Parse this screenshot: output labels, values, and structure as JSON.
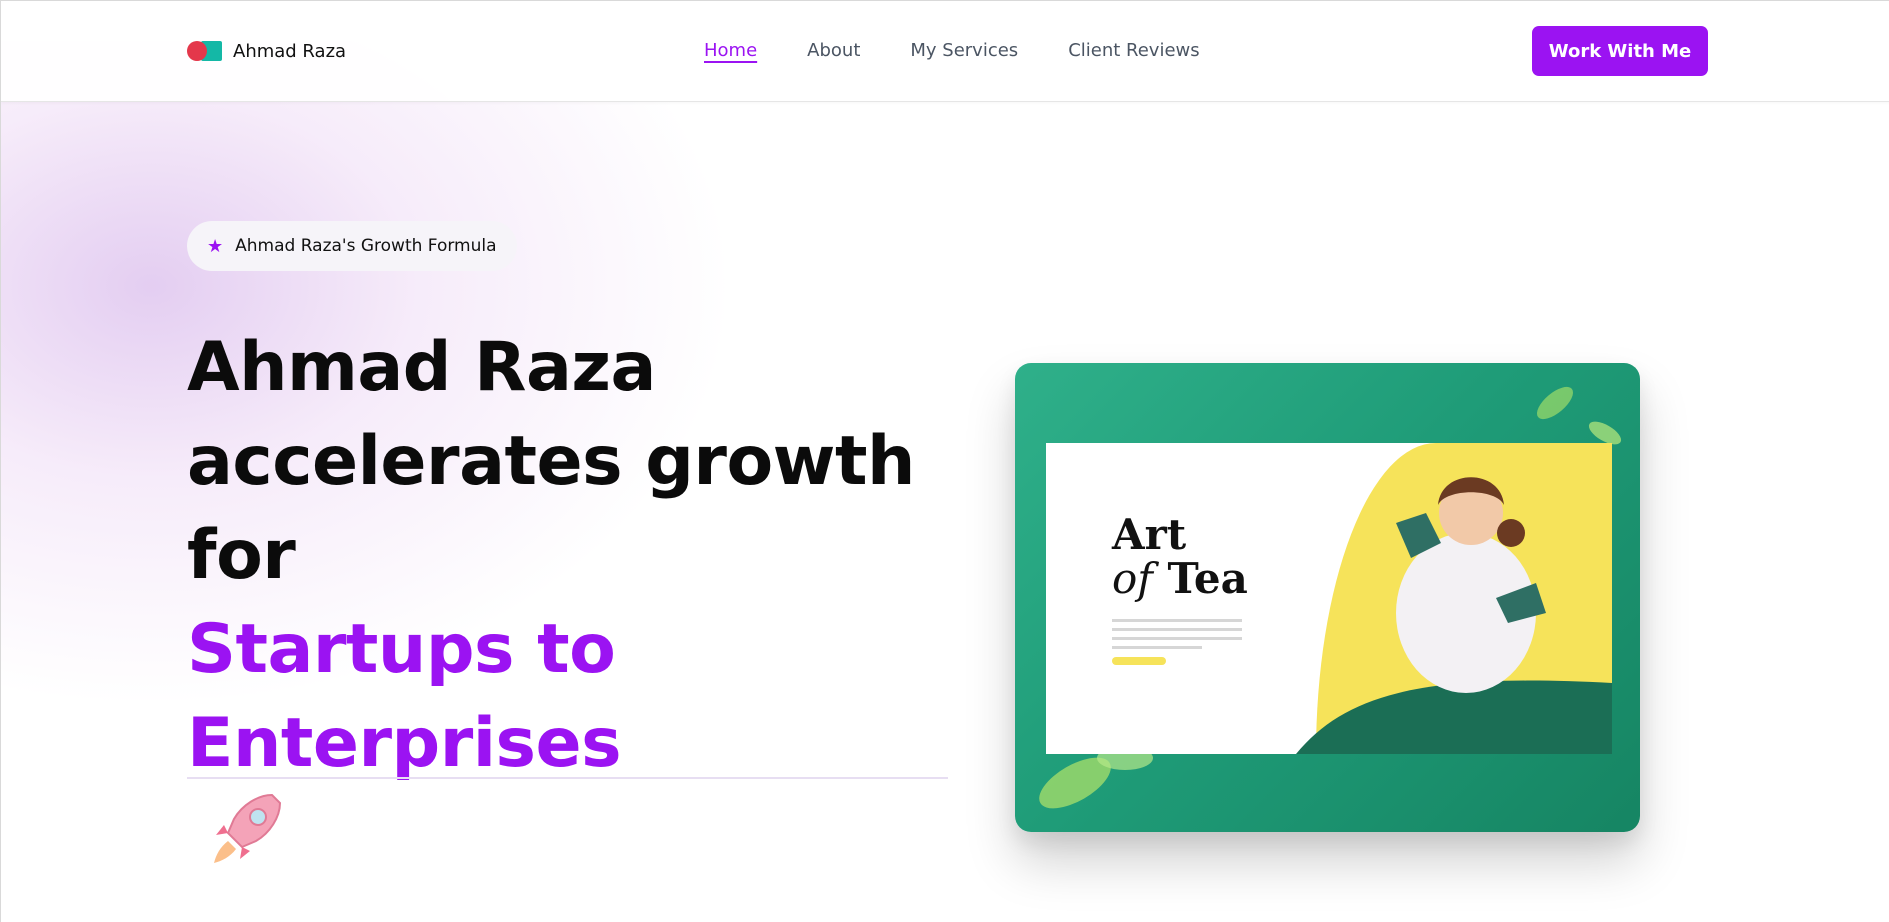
{
  "header": {
    "brand": "Ahmad Raza",
    "nav": [
      "Home",
      "About",
      "My Services",
      "Client Reviews"
    ],
    "active_nav": "Home",
    "cta": "Work With Me"
  },
  "badge": {
    "icon": "star-icon",
    "text": "Ahmad Raza's Growth Formula"
  },
  "hero": {
    "line1": "Ahmad Raza",
    "line2": "accelerates growth",
    "line3": "for",
    "accent1": "Startups to",
    "accent2": "Enterprises"
  },
  "showcase": {
    "title_line1": "Art",
    "title_line2_italic": "of",
    "title_line2": "Tea"
  },
  "colors": {
    "accent": "#9b13f2",
    "logo_red": "#e4374b",
    "logo_teal": "#14b8a6",
    "showcase_green": "#1f9c78",
    "showcase_yellow": "#f6e35a"
  }
}
